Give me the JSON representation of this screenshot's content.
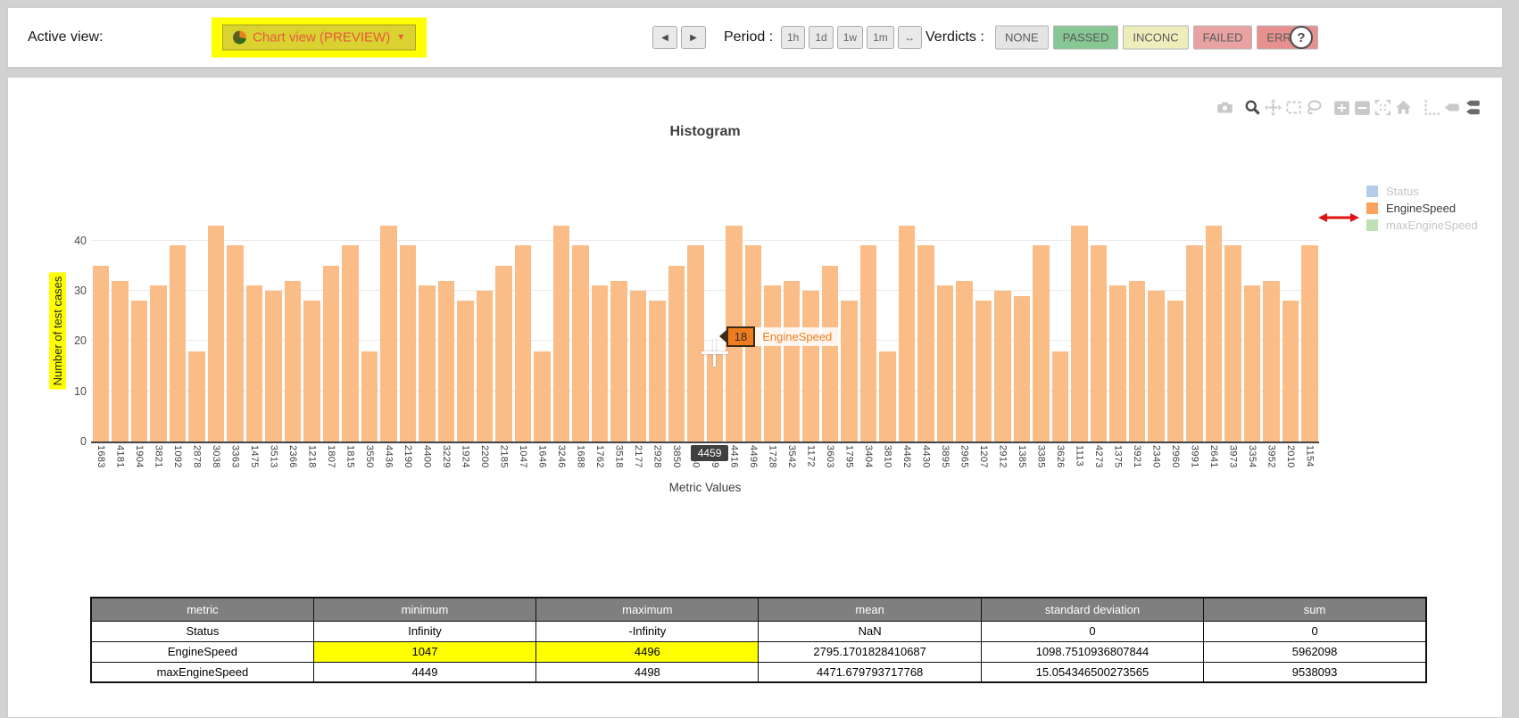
{
  "toolbar": {
    "active_view_label": "Active view:",
    "view_button": {
      "label": "Chart view (PREVIEW)",
      "caret": "▼"
    },
    "nav": {
      "prev": "◀",
      "next": "▶"
    },
    "period": {
      "label": "Period :",
      "options": [
        "1h",
        "1d",
        "1w",
        "1m",
        "↔"
      ]
    },
    "verdicts": {
      "label": "Verdicts :",
      "options": [
        {
          "label": "NONE",
          "bg": "#e4e4e4"
        },
        {
          "label": "PASSED",
          "bg": "#86c793"
        },
        {
          "label": "INCONC",
          "bg": "#eeeebd"
        },
        {
          "label": "FAILED",
          "bg": "#e9a2a2"
        },
        {
          "label": "ERROR",
          "bg": "#e79090"
        }
      ]
    },
    "help_label": "?"
  },
  "chart": {
    "title": "Histogram",
    "legend": [
      {
        "label": "Status",
        "color": "#b3cde8",
        "muted": true
      },
      {
        "label": "EngineSpeed",
        "color": "#fba35c",
        "muted": false
      },
      {
        "label": "maxEngineSpeed",
        "color": "#bfe0b3",
        "muted": true
      }
    ],
    "hover": {
      "value": "18",
      "series": "EngineSpeed",
      "axis_value": "4459"
    },
    "modebar_icons": [
      "camera",
      "zoom",
      "pan",
      "box-select",
      "lasso",
      "zoom-in",
      "zoom-out",
      "autoscale",
      "reset-axes",
      "spike-lines",
      "hover-closest",
      "hover-compare"
    ]
  },
  "chart_data": {
    "type": "bar",
    "title": "Histogram",
    "xlabel": "Metric Values",
    "ylabel": "Number of test cases",
    "yticks": [
      0,
      10,
      20,
      30,
      40
    ],
    "ylim": [
      0,
      44
    ],
    "grid": true,
    "legend_position": "right",
    "bar_color": "#fabd88",
    "hover_index": 32,
    "categories": [
      "1683",
      "4181",
      "1904",
      "3821",
      "1092",
      "2878",
      "3038",
      "3363",
      "1475",
      "3513",
      "2366",
      "1218",
      "1807",
      "1815",
      "3550",
      "4436",
      "2190",
      "4400",
      "3229",
      "1924",
      "2200",
      "2185",
      "1047",
      "1646",
      "3246",
      "1688",
      "1762",
      "3518",
      "2177",
      "2928",
      "3850",
      "4280",
      "4459",
      "4416",
      "4496",
      "1728",
      "3542",
      "1172",
      "3603",
      "1795",
      "3404",
      "3810",
      "4462",
      "4430",
      "3895",
      "2965",
      "1207",
      "2912",
      "1385",
      "3385",
      "3626",
      "1113",
      "4273",
      "1375",
      "3921",
      "2340",
      "2960",
      "3991",
      "2641",
      "3973",
      "3354",
      "3952",
      "2010",
      "1154"
    ],
    "values": [
      35,
      32,
      28,
      31,
      39,
      18,
      43,
      39,
      31,
      30,
      32,
      28,
      35,
      39,
      18,
      43,
      39,
      31,
      32,
      28,
      30,
      35,
      39,
      18,
      43,
      39,
      31,
      32,
      30,
      28,
      35,
      39,
      18,
      43,
      39,
      31,
      32,
      30,
      35,
      28,
      39,
      18,
      43,
      39,
      31,
      32,
      28,
      30,
      29,
      39,
      18,
      43,
      39,
      31,
      32,
      30,
      28,
      39,
      43,
      39,
      31,
      32,
      28,
      39
    ]
  },
  "table": {
    "headers": [
      "metric",
      "minimum",
      "maximum",
      "mean",
      "standard deviation",
      "sum"
    ],
    "rows": [
      {
        "cells": [
          "Status",
          "Infinity",
          "-Infinity",
          "NaN",
          "0",
          "0"
        ],
        "highlight": []
      },
      {
        "cells": [
          "EngineSpeed",
          "1047",
          "4496",
          "2795.1701828410687",
          "1098.7510936807844",
          "5962098"
        ],
        "highlight": [
          1,
          2
        ]
      },
      {
        "cells": [
          "maxEngineSpeed",
          "4449",
          "4498",
          "4471.679793717768",
          "15.054346500273565",
          "9538093"
        ],
        "highlight": []
      }
    ],
    "highlight_color": "#ffff00"
  },
  "colors": {
    "accent_highlight": "#ffff00",
    "view_button_text": "#e85a3c",
    "tooltip_orange": "#ef7d1e",
    "axis_tooltip_bg": "#3f3f3f",
    "table_header_bg": "#7f7f7f"
  }
}
